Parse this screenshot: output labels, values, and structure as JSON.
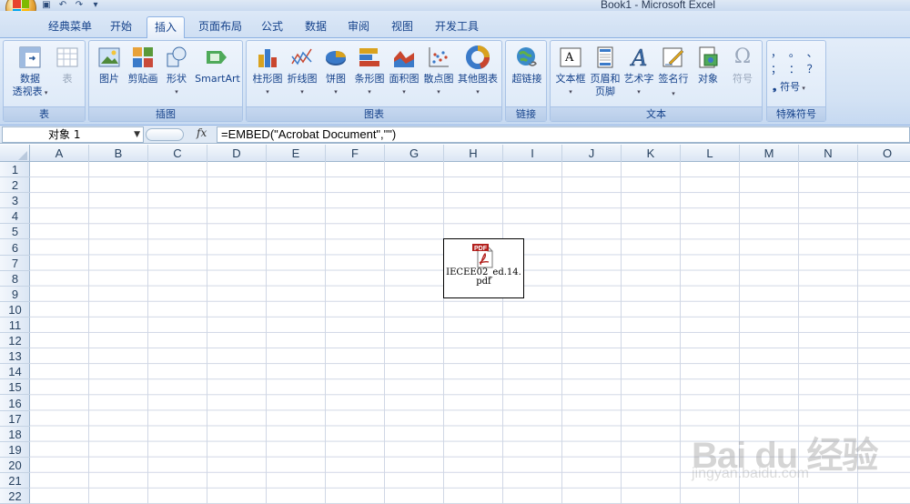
{
  "window": {
    "title": "Book1 - Microsoft Excel"
  },
  "tabs": [
    "经典菜单",
    "开始",
    "插入",
    "页面布局",
    "公式",
    "数据",
    "审阅",
    "视图",
    "开发工具"
  ],
  "active_tab": "插入",
  "ribbon": {
    "groups": {
      "table": {
        "label": "表",
        "pivot_line1": "数据",
        "pivot_line2": "透视表",
        "table": "表"
      },
      "illustrations": {
        "label": "插图",
        "picture": "图片",
        "clipart": "剪贴画",
        "shapes": "形状",
        "smartart": "SmartArt"
      },
      "charts": {
        "label": "图表",
        "column": "柱形图",
        "line": "折线图",
        "pie": "饼图",
        "bar": "条形图",
        "area": "面积图",
        "scatter": "散点图",
        "other": "其他图表"
      },
      "links": {
        "label": "链接",
        "hyperlink": "超链接"
      },
      "text": {
        "label": "文本",
        "textbox": "文本框",
        "header_line1": "页眉和",
        "header_line2": "页脚",
        "wordart": "艺术字",
        "signature": "签名行",
        "object": "对象",
        "symbol": "符号"
      },
      "special": {
        "label": "特殊符号",
        "row1": "，  。  、",
        "row2": "；  ：  ？",
        "symbol": "符号"
      }
    }
  },
  "formula_bar": {
    "name_box": "对象 1",
    "fx": "fx",
    "formula": "=EMBED(\"Acrobat Document\",\"\")"
  },
  "columns": [
    "A",
    "B",
    "C",
    "D",
    "E",
    "F",
    "G",
    "H",
    "I",
    "J",
    "K",
    "L",
    "M",
    "N",
    "O"
  ],
  "rows": [
    "1",
    "2",
    "3",
    "4",
    "5",
    "6",
    "7",
    "8",
    "9",
    "10",
    "11",
    "12",
    "13",
    "14",
    "15",
    "16",
    "17",
    "18",
    "19",
    "20",
    "21",
    "22"
  ],
  "embedded_object": {
    "icon_label": "PDF",
    "filename": "IECEE02_ed.14.pdf"
  },
  "watermark": {
    "brand": "Bai du 经验",
    "url": "jingyan.baidu.com"
  }
}
